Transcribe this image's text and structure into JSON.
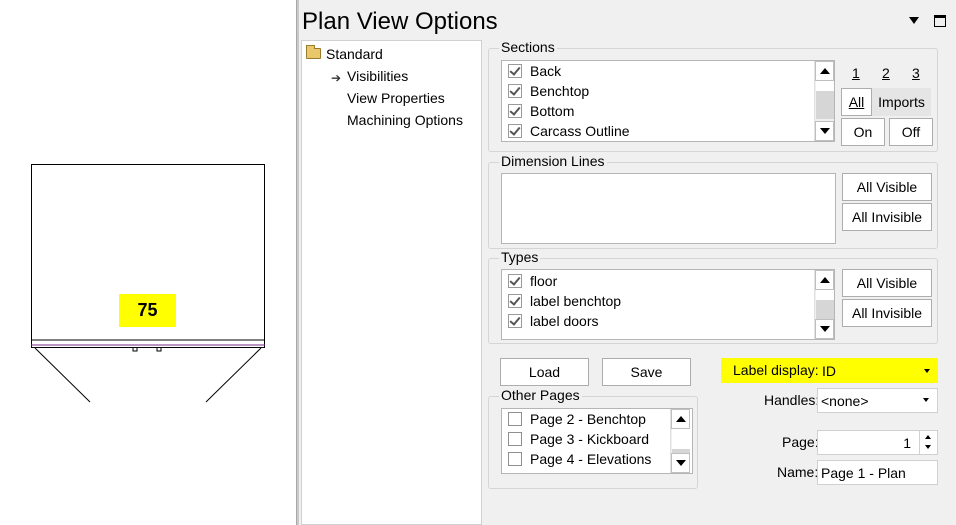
{
  "canvas": {
    "cabinet_label": "75"
  },
  "panel": {
    "title": "Plan View Options",
    "tree": {
      "root": "Standard",
      "items": [
        "Visibilities",
        "View Properties",
        "Machining Options"
      ]
    },
    "sections": {
      "title": "Sections",
      "items": [
        {
          "label": "Back",
          "checked": true
        },
        {
          "label": "Benchtop",
          "checked": true
        },
        {
          "label": "Bottom",
          "checked": true
        },
        {
          "label": "Carcass Outline",
          "checked": true
        }
      ],
      "pages": [
        "1",
        "2",
        "3"
      ],
      "all_label": "All",
      "imports_label": "Imports",
      "on_label": "On",
      "off_label": "Off"
    },
    "dimension_lines": {
      "title": "Dimension Lines",
      "all_visible_label": "All Visible",
      "all_invisible_label": "All Invisible"
    },
    "types": {
      "title": "Types",
      "items": [
        {
          "label": "floor",
          "checked": true
        },
        {
          "label": "label benchtop",
          "checked": true
        },
        {
          "label": "label doors",
          "checked": true
        }
      ],
      "all_visible_label": "All Visible",
      "all_invisible_label": "All Invisible"
    },
    "load_label": "Load",
    "save_label": "Save",
    "other_pages": {
      "title": "Other Pages",
      "items": [
        {
          "label": "Page 2 - Benchtop",
          "checked": false
        },
        {
          "label": "Page 3 - Kickboard",
          "checked": false
        },
        {
          "label": "Page 4 - Elevations",
          "checked": false
        }
      ]
    },
    "label_display": {
      "label": "Label display:",
      "value": "ID"
    },
    "handles": {
      "label": "Handles:",
      "value": "<none>"
    },
    "page": {
      "label": "Page:",
      "value": "1"
    },
    "name": {
      "label": "Name:",
      "value": "Page 1 - Plan"
    }
  },
  "colors": {
    "highlight": "#ffff00",
    "panel_bg": "#f0f0f0"
  }
}
